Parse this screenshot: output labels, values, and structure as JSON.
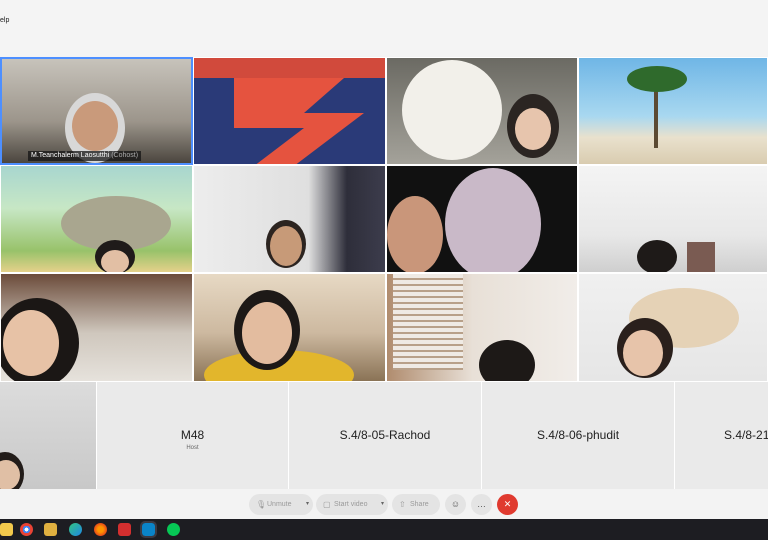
{
  "menu": {
    "help_label": "elp"
  },
  "participants": [
    {
      "name": "M.Teanchalerm Laosutthi",
      "role": "(Cohost)"
    },
    {
      "name": ""
    }
  ],
  "bottom_tiles": [
    {
      "name": "M48",
      "sub": "Host"
    },
    {
      "name": "S.4/8-05-Rachod",
      "sub": ""
    },
    {
      "name": "S.4/8-06-phudit",
      "sub": ""
    },
    {
      "name": "S.4/8-21",
      "sub": ""
    }
  ],
  "controls": {
    "unmute": "Unmute",
    "start_video": "Start video",
    "share": "Share",
    "more": "…",
    "emoji": "☺",
    "leave": "✕"
  },
  "colors": {
    "active_border": "#4d8fff",
    "leave_button": "#e03a2f"
  },
  "taskbar_icons": [
    "file-explorer-icon",
    "chrome-icon",
    "file-manager-icon",
    "edge-icon",
    "firefox-icon",
    "pdf-icon",
    "webex-icon",
    "line-icon"
  ]
}
